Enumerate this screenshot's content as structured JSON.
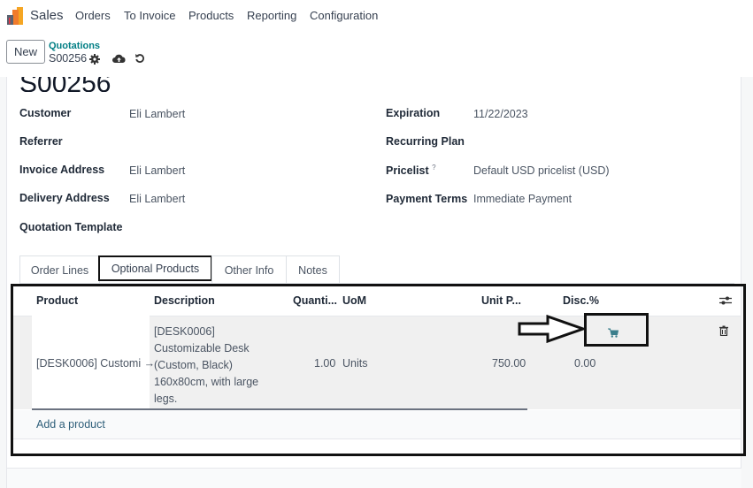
{
  "app": {
    "name": "Sales",
    "logo_icon": "sales-logo-icon"
  },
  "topnav": {
    "items": [
      "Orders",
      "To Invoice",
      "Products",
      "Reporting",
      "Configuration"
    ]
  },
  "control_panel": {
    "new_label": "New",
    "breadcrumb_parent": "Quotations",
    "breadcrumb_current": "S00256",
    "icons": [
      "gear-icon",
      "cloud-upload-icon",
      "undo-icon"
    ]
  },
  "record": {
    "title": "S00256",
    "left_fields": [
      {
        "label": "Customer",
        "value": "Eli Lambert"
      },
      {
        "label": "Referrer",
        "value": ""
      },
      {
        "label": "Invoice Address",
        "value": "Eli Lambert"
      },
      {
        "label": "Delivery Address",
        "value": "Eli Lambert"
      },
      {
        "label": "Quotation Template",
        "value": ""
      }
    ],
    "right_fields": [
      {
        "label": "Expiration",
        "value": "11/22/2023"
      },
      {
        "label": "Recurring Plan",
        "value": ""
      },
      {
        "label": "Pricelist",
        "help": "?",
        "value": "Default USD pricelist (USD)"
      },
      {
        "label": "Payment Terms",
        "value": "Immediate Payment"
      }
    ]
  },
  "tabs": [
    {
      "label": "Order Lines",
      "active": false
    },
    {
      "label": "Optional Products",
      "active": true
    },
    {
      "label": "Other Info",
      "active": false
    },
    {
      "label": "Notes",
      "active": false
    }
  ],
  "table": {
    "columns": [
      "Product",
      "Description",
      "Quanti...",
      "UoM",
      "Unit P...",
      "Disc.%"
    ],
    "rows": [
      {
        "product": "[DESK0006] Customi",
        "description": "[DESK0006] Customizable Desk (Custom, Black) 160x80cm, with large legs.",
        "quantity": "1.00",
        "uom": "Units",
        "unit_price": "750.00",
        "discount": "0.00"
      }
    ],
    "add_label": "Add a product"
  },
  "colors": {
    "accent": "#017e84",
    "link": "#2f5f7a",
    "cart": "#3c7f8c"
  }
}
